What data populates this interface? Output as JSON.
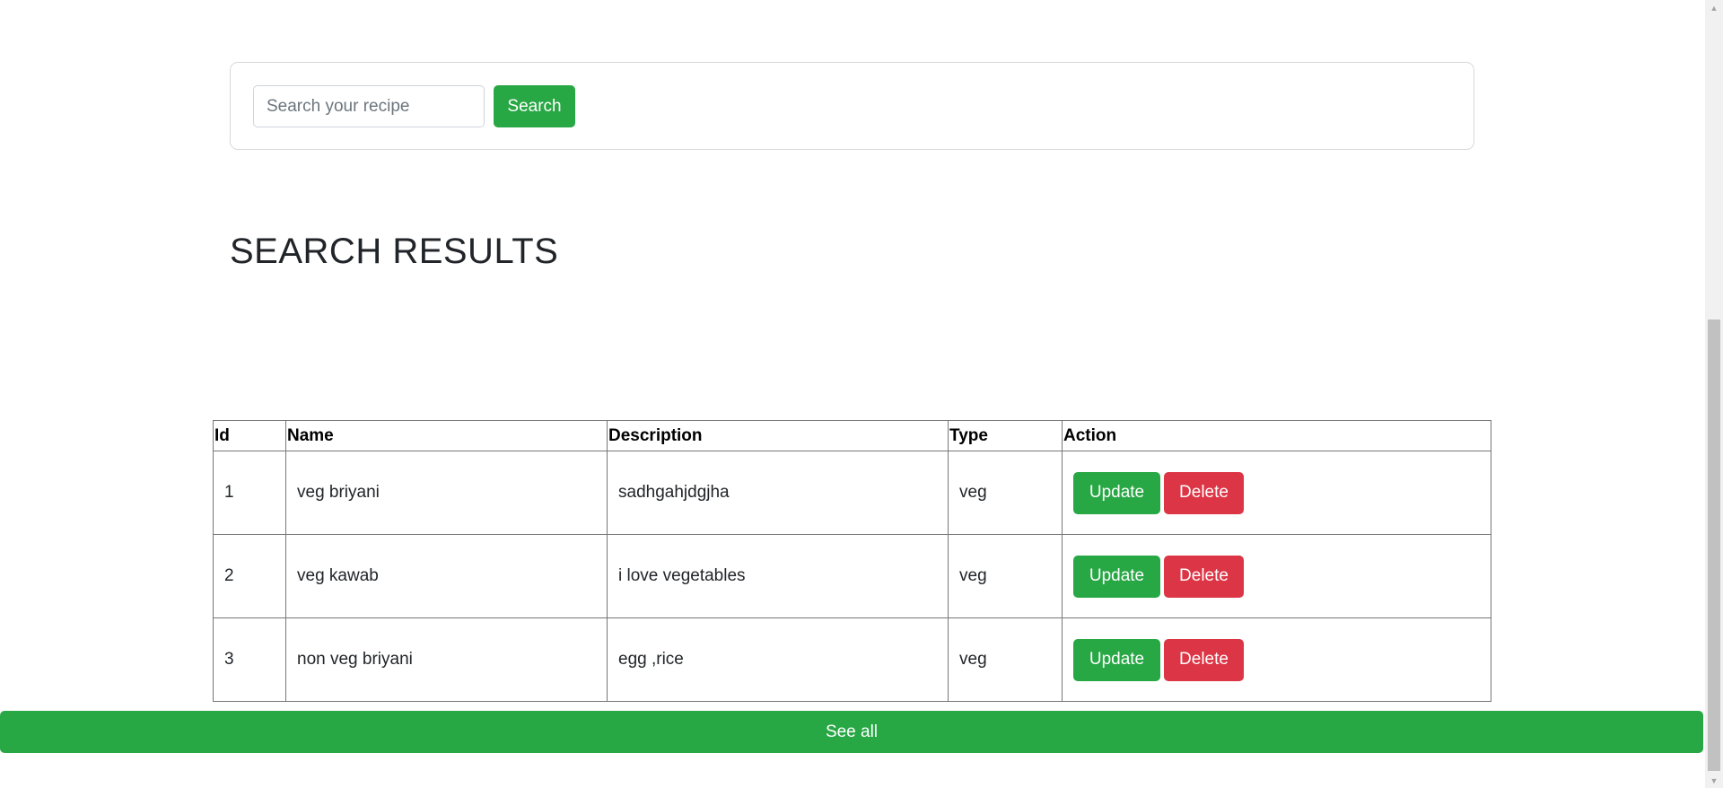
{
  "search": {
    "placeholder": "Search your recipe",
    "value": "",
    "button_label": "Search"
  },
  "results": {
    "heading": "SEARCH RESULTS",
    "columns": [
      "Id",
      "Name",
      "Description",
      "Type",
      "Action"
    ],
    "rows": [
      {
        "id": "1",
        "name": "veg briyani",
        "description": "sadhgahjdgjha",
        "type": "veg"
      },
      {
        "id": "2",
        "name": "veg kawab",
        "description": "i love vegetables",
        "type": "veg"
      },
      {
        "id": "3",
        "name": "non veg briyani",
        "description": "egg ,rice",
        "type": "veg"
      }
    ],
    "update_label": "Update",
    "delete_label": "Delete"
  },
  "see_all_label": "See all",
  "colors": {
    "primary_green": "#28a745",
    "danger_red": "#dc3545",
    "text": "#212529"
  },
  "icons": {
    "scroll_up": "triangle-up-icon",
    "scroll_down": "triangle-down-icon"
  }
}
